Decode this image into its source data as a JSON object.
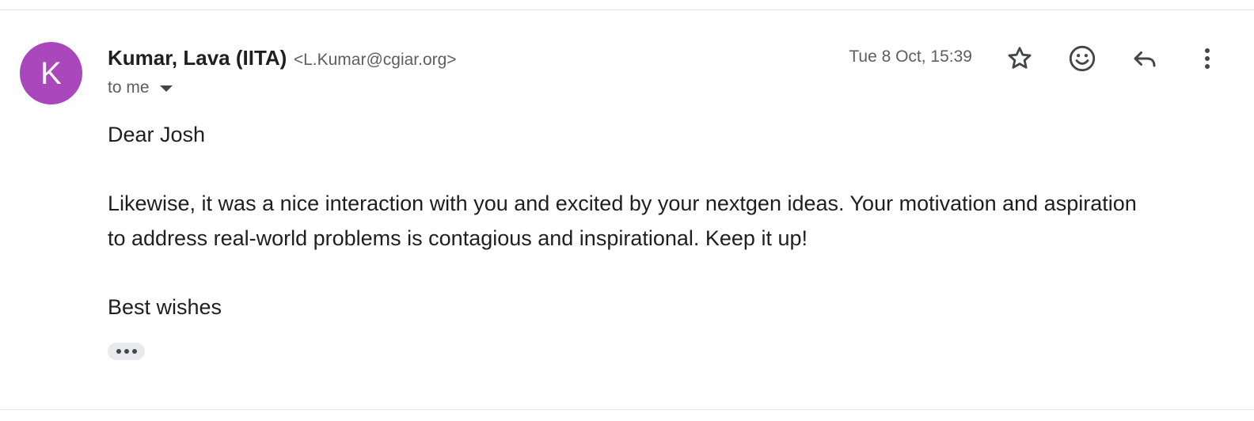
{
  "colors": {
    "avatar_bg": "#ab47bc",
    "icon": "#444746",
    "secondary_text": "#5e5e5e"
  },
  "message": {
    "avatar_initial": "K",
    "sender_name": "Kumar, Lava (IITA)",
    "sender_email": "<L.Kumar@cgiar.org>",
    "recipient_label": "to me",
    "timestamp": "Tue 8 Oct, 15:39",
    "body": {
      "greeting": "Dear Josh",
      "paragraph_line_1": "Likewise, it was a nice interaction with you and excited by your nextgen ideas. Your motivation and aspiration",
      "paragraph_line_2": "to address real-world problems is contagious and inspirational. Keep it up!",
      "closing": "Best wishes"
    }
  },
  "actions": [
    {
      "name": "star",
      "icon": "star-icon"
    },
    {
      "name": "add-reaction",
      "icon": "smiley-icon"
    },
    {
      "name": "reply",
      "icon": "reply-icon"
    },
    {
      "name": "more",
      "icon": "more-vertical-icon"
    }
  ],
  "trimmed_content_indicator": "show-trimmed-content-icon"
}
